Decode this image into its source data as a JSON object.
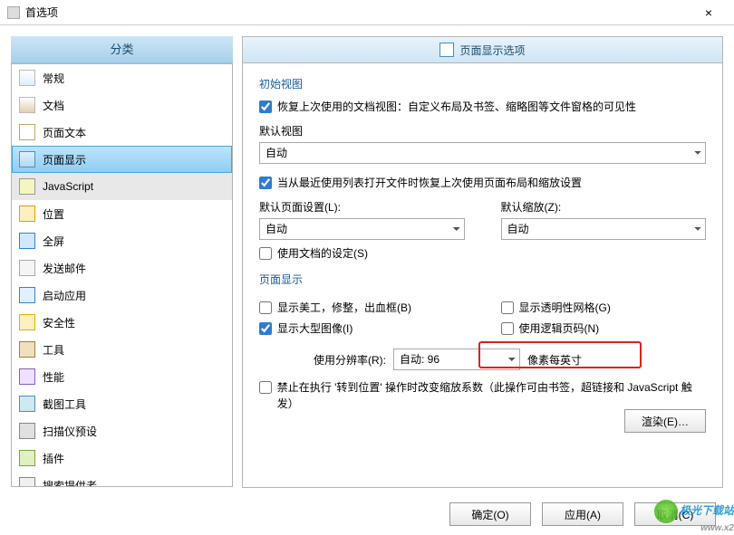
{
  "window": {
    "title": "首选项",
    "close": "×"
  },
  "sidebar": {
    "header": "分类",
    "items": [
      {
        "label": "常规"
      },
      {
        "label": "文档"
      },
      {
        "label": "页面文本"
      },
      {
        "label": "页面显示"
      },
      {
        "label": "JavaScript"
      },
      {
        "label": "位置"
      },
      {
        "label": "全屏"
      },
      {
        "label": "发送邮件"
      },
      {
        "label": "启动应用"
      },
      {
        "label": "安全性"
      },
      {
        "label": "工具"
      },
      {
        "label": "性能"
      },
      {
        "label": "截图工具"
      },
      {
        "label": "扫描仪预设"
      },
      {
        "label": "插件"
      },
      {
        "label": "搜索提供者"
      }
    ]
  },
  "main": {
    "header": "页面显示选项",
    "initial_view": {
      "title": "初始视图",
      "restore": "恢复上次使用的文档视图：自定义布局及书签、缩略图等文件窗格的可见性",
      "default_view_label": "默认视图",
      "default_view_value": "自动",
      "restore_layout": "当从最近使用列表打开文件时恢复上次使用页面布局和缩放设置",
      "default_layout_label": "默认页面设置(L):",
      "default_layout_value": "自动",
      "default_zoom_label": "默认缩放(Z):",
      "default_zoom_value": "自动",
      "use_doc_settings": "使用文档的设定(S)"
    },
    "page_display": {
      "title": "页面显示",
      "art_trim": "显示美工，修整，出血框(B)",
      "large_images": "显示大型图像(I)",
      "transparency_grid": "显示透明性网格(G)",
      "logical_pages": "使用逻辑页码(N)",
      "resolution_label": "使用分辨率(R):",
      "resolution_value": "自动: 96",
      "resolution_unit": "像素每英寸",
      "forbid": "禁止在执行 '转到位置' 操作时改变缩放系数（此操作可由书签，超链接和 JavaScript 触发）",
      "render": "渲染(E)…"
    }
  },
  "footer": {
    "ok": "确定(O)",
    "apply": "应用(A)",
    "cancel": "取消(C)"
  },
  "watermark": {
    "brand": "极光下载站",
    "url": "www.x2"
  }
}
